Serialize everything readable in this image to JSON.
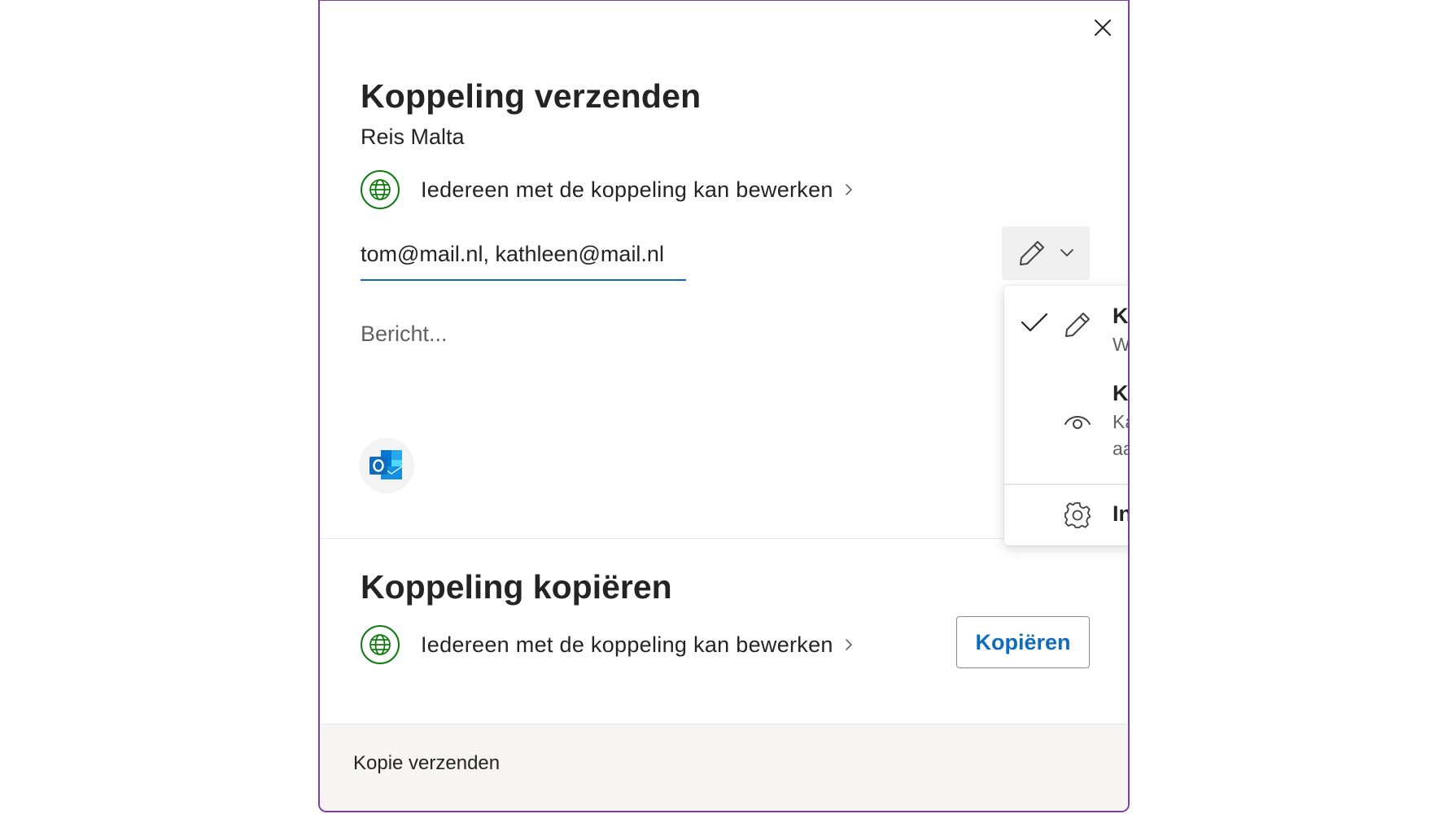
{
  "dialog": {
    "title": "Koppeling verzenden",
    "item_name": "Reis Malta",
    "link_permission": "Iedereen met de koppeling kan bewerken",
    "recipients": "tom@mail.nl, kathleen@mail.nl",
    "message_placeholder": "Bericht...",
    "outlook_icon": "outlook-icon"
  },
  "permission_menu": {
    "items": [
      {
        "title": "Kan bewerken",
        "subtitle": "Wijzigingen aanbrengen",
        "icon": "pencil-icon",
        "selected": true
      },
      {
        "title": "Kan weergeven",
        "subtitle": "Kan geen wijzigingen aanbrengen",
        "icon": "eye-icon",
        "selected": false
      }
    ],
    "settings_label": "Instellingen voor delen"
  },
  "copy_section": {
    "title": "Koppeling kopiëren",
    "link_permission": "Iedereen met de koppeling kan bewerken",
    "copy_button": "Kopiëren"
  },
  "footer": {
    "send_copy": "Kopie verzenden"
  },
  "colors": {
    "accent": "#0f6cbd",
    "globe_green": "#107c10",
    "dialog_border": "#7b3fa8"
  }
}
